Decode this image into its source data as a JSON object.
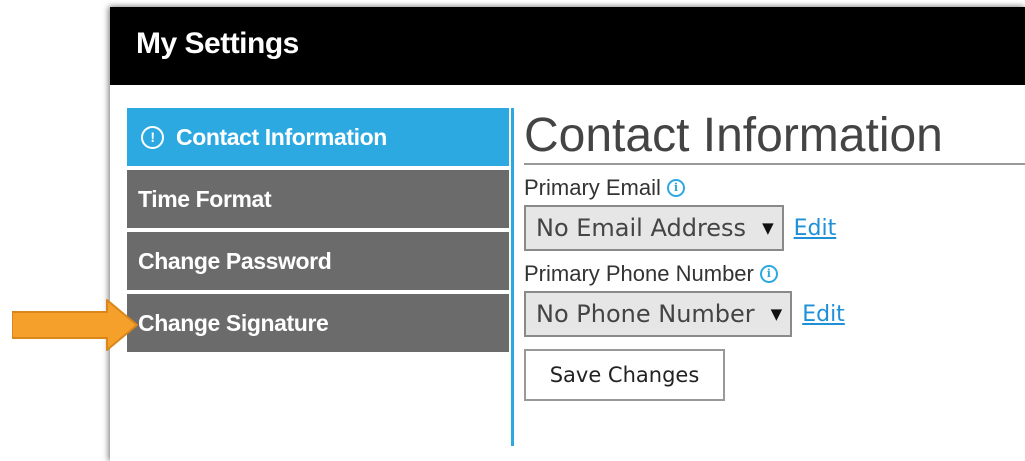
{
  "window": {
    "title": "My Settings"
  },
  "sidebar": {
    "items": [
      {
        "label": "Contact Information",
        "active": true,
        "icon": "alert-circle-icon"
      },
      {
        "label": "Time Format",
        "active": false
      },
      {
        "label": "Change Password",
        "active": false
      },
      {
        "label": "Change Signature",
        "active": false
      }
    ]
  },
  "content": {
    "heading": "Contact Information",
    "email": {
      "label": "Primary Email",
      "info_icon": "info-icon",
      "selected": "No Email Address",
      "edit_label": "Edit"
    },
    "phone": {
      "label": "Primary Phone Number",
      "info_icon": "info-icon",
      "selected": "No Phone Number",
      "edit_label": "Edit"
    },
    "save_label": "Save Changes"
  },
  "annotation": {
    "icon": "arrow-right-icon",
    "color": "#f5a02a"
  },
  "colors": {
    "accent": "#2da9e1",
    "nav_bg": "#6b6b6b",
    "titlebar": "#000000"
  }
}
